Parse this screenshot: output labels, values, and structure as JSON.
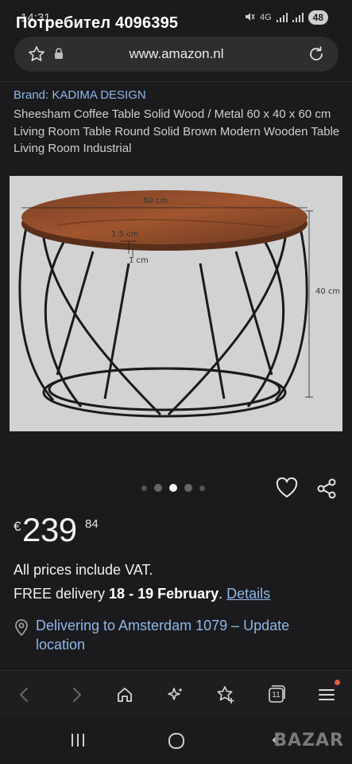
{
  "status_bar": {
    "time": "14:31",
    "user_title": "Потребител 4096395",
    "network": "4G",
    "battery": "48"
  },
  "browser": {
    "url": "www.amazon.nl"
  },
  "product": {
    "brand": "Brand: KADIMA DESIGN",
    "title": "Sheesham Coffee Table Solid Wood / Metal 60 x 40 x 60 cm Living Room Table Round Solid Brown Modern Wooden Table Living Room Industrial",
    "image_dimensions": {
      "width": "60 cm",
      "top_thickness": "1.5 cm",
      "leg": "1 cm",
      "height": "40 cm"
    },
    "carousel": {
      "count": 5,
      "active_index": 2
    }
  },
  "price": {
    "currency": "€",
    "whole": "239",
    "fraction": "84"
  },
  "vat_text": "All prices include VAT.",
  "delivery": {
    "prefix": "FREE delivery ",
    "dates": "18 - 19 February",
    "separator": ". ",
    "details_link": "Details"
  },
  "location": {
    "text": "Delivering to Amsterdam 1079 – Update location"
  },
  "toolbar": {
    "tab_count": "11"
  },
  "watermark": "BAZAR",
  "colors": {
    "background": "#1b1b1d",
    "link": "#8fb7ea",
    "notification_dot": "#e85d3a"
  }
}
